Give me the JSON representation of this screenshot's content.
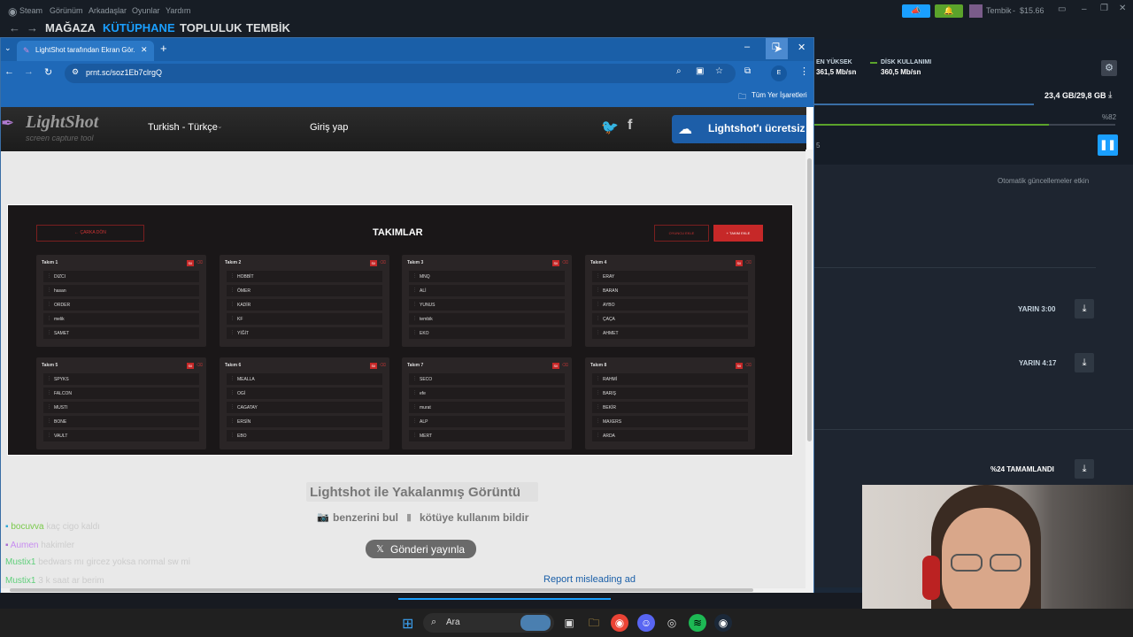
{
  "steam": {
    "menu": [
      "Steam",
      "Görünüm",
      "Arkadaşlar",
      "Oyunlar",
      "Yardım"
    ],
    "nav": [
      "MAĞAZA",
      "KÜTÜPHANE",
      "TOPLULUK",
      "TEMBİK"
    ],
    "user": "Tembik",
    "balance": "$15.66",
    "stats": {
      "peak_label": "EN YÜKSEK",
      "peak_value": "361,5 Mb/sn",
      "disk_label": "DİSK KULLANIMI",
      "disk_value": "360,5 Mb/sn"
    },
    "storage": "23,4 GB/29,8 GB",
    "progress_pct": "%82",
    "side_number": "5",
    "auto_updates": "Otomatik güncellemeler etkin",
    "schedule1": "YARIN 3:00",
    "schedule2": "YARIN 4:17",
    "complete": "%24 TAMAMLANDI"
  },
  "chrome": {
    "tab_title": "LightShot tarafından Ekran Gör...",
    "url": "prnt.sc/soz1Eb7clrgQ",
    "bookmarks_label": "Tüm Yer İşaretleri",
    "profile_letter": "E"
  },
  "lightshot": {
    "logo": "LightShot",
    "logo_sub": "screen capture tool",
    "language": "Turkish - Türkçe",
    "login": "Giriş yap",
    "promo": "Lightshot'ı ücretsiz",
    "caption": "Lightshot ile Yakalanmış Görüntü",
    "find_similar": "benzerini bul",
    "report_abuse": "kötüye kullanım bildir",
    "post": "Gönderi yayınla",
    "report_ad": "Report misleading ad"
  },
  "screenshot": {
    "back": "← ÇARKA DÖN",
    "title": "TAKIMLAR",
    "add_player": "OYUNCU EKLE",
    "add_team": "+ TAKIM EKLE",
    "edit": "Sil",
    "teams": [
      {
        "name": "Takım 1",
        "players": [
          "DIZCI",
          "hasan",
          "ORDER",
          "melik",
          "SAMET"
        ]
      },
      {
        "name": "Takım 2",
        "players": [
          "HOBBİT",
          "ÖMER",
          "KADİR",
          "KF",
          "YİĞİT"
        ]
      },
      {
        "name": "Takım 3",
        "players": [
          "MNQ",
          "ALİ",
          "YUNUS",
          "tembik",
          "EKO"
        ]
      },
      {
        "name": "Takım 4",
        "players": [
          "ERAY",
          "BARAN",
          "AYBO",
          "ÇAÇA",
          "AHMET"
        ]
      },
      {
        "name": "Takım 5",
        "players": [
          "SPYKS",
          "FALCON",
          "MUSTI",
          "BONE",
          "VAULT"
        ]
      },
      {
        "name": "Takım 6",
        "players": [
          "MEALLA",
          "OGİ",
          "CAGATAY",
          "ERSİN",
          "EBO"
        ]
      },
      {
        "name": "Takım 7",
        "players": [
          "SECO",
          "efe",
          "murat",
          "ALP",
          "MERT"
        ]
      },
      {
        "name": "Takım 8",
        "players": [
          "RAHMİ",
          "BARIŞ",
          "BEKİR",
          "MAXERS",
          "ARDA"
        ]
      }
    ]
  },
  "chat": [
    {
      "user": "bocuvva",
      "msg": "kaç cigo kaldı"
    },
    {
      "user": "Aumen",
      "msg": "hakimler"
    },
    {
      "user": "Mustix1",
      "msg": "bedwars mı gircez yoksa normal sw mi"
    },
    {
      "user": "Mustix1",
      "msg": "3 k saat ar berim"
    }
  ],
  "taskbar": {
    "search": "Ara"
  }
}
